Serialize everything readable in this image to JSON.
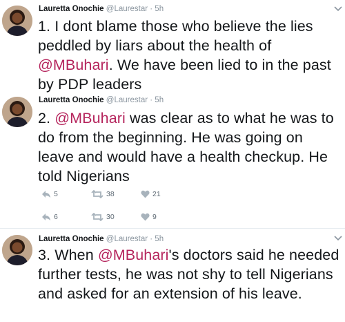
{
  "tweets": [
    {
      "author_name": "Lauretta Onochie",
      "handle": "@Laurestar",
      "separator": "·",
      "time": "5h",
      "text_prefix": "1. I dont blame those who believe the lies peddled by liars about the health of ",
      "mention": "@MBuhari",
      "text_suffix": ". We have been lied to in the past by PDP leaders"
    },
    {
      "author_name": "Lauretta Onochie",
      "handle": "@Laurestar",
      "separator": "·",
      "time": "5h",
      "text_prefix": "2. ",
      "mention": "@MBuhari",
      "text_suffix": " was clear as to what he was to do from the beginning. He was going on leave and would have a health checkup. He told Nigerians",
      "actions": {
        "replies": "5",
        "retweets": "38",
        "likes": "21"
      },
      "actions_second": {
        "replies": "6",
        "retweets": "30",
        "likes": "9"
      }
    },
    {
      "author_name": "Lauretta Onochie",
      "handle": "@Laurestar",
      "separator": "·",
      "time": "5h",
      "text_prefix": "3. When ",
      "mention": "@MBuhari",
      "text_suffix": "'s doctors said he needed further tests, he was not shy to tell Nigerians and asked for an extension of his leave."
    }
  ],
  "icons": {
    "reply": "reply-icon",
    "retweet": "retweet-icon",
    "like": "heart-icon",
    "caret": "chevron-down-icon"
  },
  "colors": {
    "mention": "#b5245c",
    "meta": "#8a959f",
    "action_icon": "#a8b3bc"
  }
}
